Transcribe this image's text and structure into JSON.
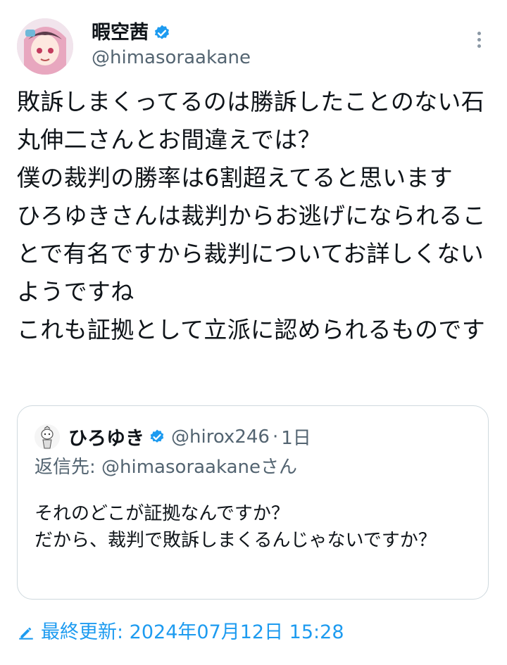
{
  "author": {
    "display_name": "暇空茜",
    "handle": "@himasoraakane",
    "verified_icon": "verified-badge-icon",
    "accent": "#1d9bf0"
  },
  "tweet": {
    "text": "敗訴しまくってるのは勝訴したことのない石丸伸二さんとお間違えでは？\n僕の裁判の勝率は6割超えてると思います\nひろゆきさんは裁判からお逃げになられることで有名ですから裁判についてお詳しくないようですね\nこれも証拠として立派に認められるものです"
  },
  "quote": {
    "display_name": "ひろゆき",
    "handle": "@hirox246",
    "separator": "·",
    "time": "1日",
    "reply_to": "返信先: @himasoraakaneさん",
    "text": "それのどこが証拠なんですか？\nだから、裁判で敗訴しまくるんじゃないですか？"
  },
  "footer": {
    "updated": "最終更新: 2024年07月12日 15:28",
    "icon": "pencil-icon"
  },
  "more_icon": "more-options-icon"
}
